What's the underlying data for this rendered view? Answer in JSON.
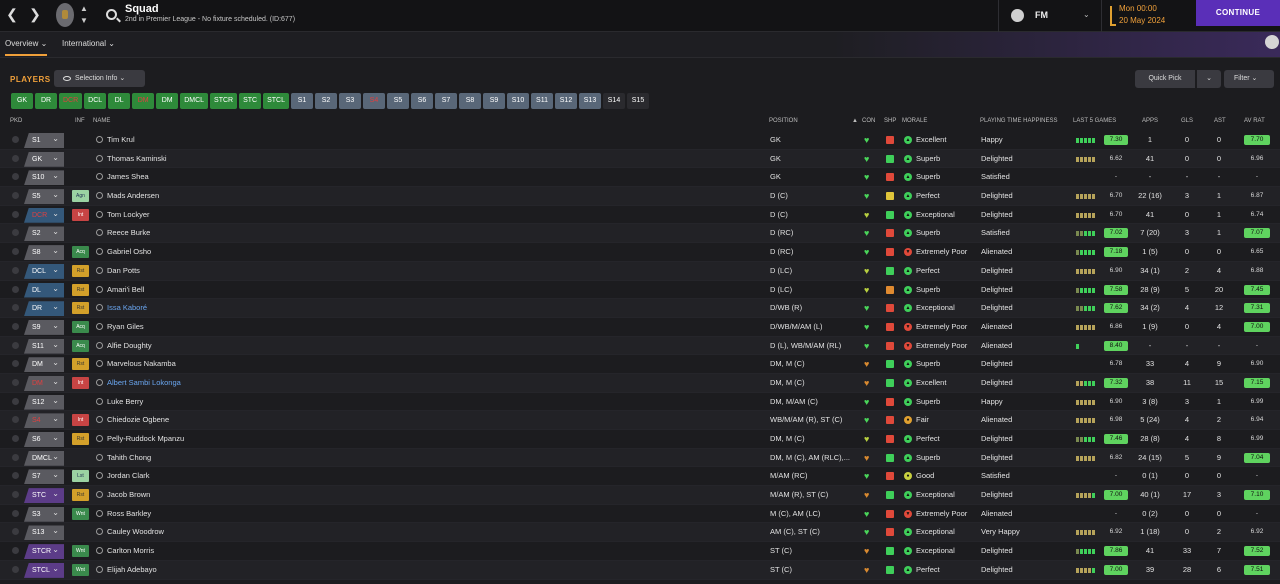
{
  "header": {
    "back_icon": "chevron-left-icon",
    "forward_icon": "chevron-right-icon",
    "title": "Squad",
    "subtitle": "2nd in Premier League - No fixture scheduled. (ID:677)",
    "user": "FM",
    "time": "Mon 00:00",
    "date": "20 May 2024",
    "continue_label": "CONTINUE"
  },
  "tabs": [
    {
      "label": "Overview ⌄"
    },
    {
      "label": "International ⌄"
    }
  ],
  "toolbar": {
    "players_label": "PLAYERS",
    "selection_info_label": "Selection Info ⌄",
    "quick_pick_label": "Quick Pick",
    "quick_pick_dd": "⌄",
    "filter_label": "Filter ⌄"
  },
  "position_chips": [
    {
      "label": "GK",
      "style": "g"
    },
    {
      "label": "DR",
      "style": "g"
    },
    {
      "label": "DCR",
      "style": "gr"
    },
    {
      "label": "DCL",
      "style": "g"
    },
    {
      "label": "DL",
      "style": "g"
    },
    {
      "label": "DM",
      "style": "gr"
    },
    {
      "label": "DM",
      "style": "g"
    },
    {
      "label": "DMCL",
      "style": "g"
    },
    {
      "label": "STCR",
      "style": "g"
    },
    {
      "label": "STC",
      "style": "g"
    },
    {
      "label": "STCL",
      "style": "g"
    },
    {
      "label": "S1",
      "style": "s"
    },
    {
      "label": "S2",
      "style": "s"
    },
    {
      "label": "S3",
      "style": "s"
    },
    {
      "label": "S4",
      "style": "sr"
    },
    {
      "label": "S5",
      "style": "s"
    },
    {
      "label": "S6",
      "style": "s"
    },
    {
      "label": "S7",
      "style": "s"
    },
    {
      "label": "S8",
      "style": "s"
    },
    {
      "label": "S9",
      "style": "s"
    },
    {
      "label": "S10",
      "style": "s"
    },
    {
      "label": "S11",
      "style": "s"
    },
    {
      "label": "S12",
      "style": "s"
    },
    {
      "label": "S13",
      "style": "s"
    },
    {
      "label": "S14",
      "style": "d"
    },
    {
      "label": "S15",
      "style": "d"
    }
  ],
  "columns": {
    "pkd": "PKD",
    "inf": "INF",
    "name": "NAME",
    "position": "POSITION",
    "con": "CON",
    "shp": "SHP",
    "morale": "MORALE",
    "pth": "PLAYING TIME HAPPINESS",
    "last5": "LAST 5 GAMES",
    "apps": "APPS",
    "gls": "GLS",
    "ast": "AST",
    "avrat": "AV RAT"
  },
  "players": [
    {
      "pkd": "S1",
      "pkd_style": "",
      "pkd_red": false,
      "inf": "",
      "name": "Tim Krul",
      "link": false,
      "position": "GK",
      "con": "#4ad65a",
      "shp": "red",
      "morale": "Excellent",
      "morale_icon": "up",
      "pth": "Happy",
      "bars": [
        "g",
        "g",
        "g",
        "g",
        "g"
      ],
      "last5": "7.30",
      "l5": "gr",
      "apps": "1",
      "gls": "0",
      "ast": "0",
      "avrat": "7.70",
      "av": "gr"
    },
    {
      "pkd": "GK",
      "pkd_style": "",
      "pkd_red": false,
      "inf": "",
      "name": "Thomas Kaminski",
      "link": false,
      "position": "GK",
      "con": "#4ad65a",
      "shp": "green",
      "morale": "Superb",
      "morale_icon": "up2",
      "pth": "Delighted",
      "bars": [
        "y",
        "y",
        "y",
        "y",
        "y"
      ],
      "last5": "6.62",
      "l5": "no",
      "apps": "41",
      "gls": "0",
      "ast": "0",
      "avrat": "6.96",
      "av": "no"
    },
    {
      "pkd": "S10",
      "pkd_style": "",
      "pkd_red": false,
      "inf": "",
      "name": "James Shea",
      "link": false,
      "position": "GK",
      "con": "#4ad65a",
      "shp": "red",
      "morale": "Superb",
      "morale_icon": "up2",
      "pth": "Satisfied",
      "bars": [],
      "last5": "-",
      "l5": "no",
      "apps": "-",
      "gls": "-",
      "ast": "-",
      "avrat": "-",
      "av": "no"
    },
    {
      "pkd": "S5",
      "pkd_style": "",
      "pkd_red": false,
      "inf": "Agn",
      "inf_style": "lg",
      "name": "Mads Andersen",
      "link": false,
      "position": "D (C)",
      "con": "#4ad65a",
      "shp": "yellow",
      "morale": "Perfect",
      "morale_icon": "up2",
      "pth": "Delighted",
      "bars": [
        "y",
        "y",
        "y",
        "y",
        "y"
      ],
      "last5": "6.70",
      "l5": "no",
      "apps": "22 (16)",
      "gls": "3",
      "ast": "1",
      "avrat": "6.87",
      "av": "no"
    },
    {
      "pkd": "DCR",
      "pkd_style": "b",
      "pkd_red": true,
      "inf": "Int",
      "inf_style": "red",
      "name": "Tom Lockyer",
      "link": false,
      "position": "D (C)",
      "con": "#b8d040",
      "shp": "green",
      "morale": "Exceptional",
      "morale_icon": "up2",
      "pth": "Delighted",
      "bars": [
        "y",
        "y",
        "y",
        "y",
        "y"
      ],
      "last5": "6.70",
      "l5": "no",
      "apps": "41",
      "gls": "0",
      "ast": "1",
      "avrat": "6.74",
      "av": "no"
    },
    {
      "pkd": "S2",
      "pkd_style": "",
      "pkd_red": false,
      "inf": "",
      "name": "Reece Burke",
      "link": false,
      "position": "D (RC)",
      "con": "#4ad65a",
      "shp": "red",
      "morale": "Superb",
      "morale_icon": "up2",
      "pth": "Satisfied",
      "bars": [
        "dg",
        "dg",
        "g",
        "g",
        "g"
      ],
      "last5": "7.02",
      "l5": "gr",
      "apps": "7 (20)",
      "gls": "3",
      "ast": "1",
      "avrat": "7.07",
      "av": "gr"
    },
    {
      "pkd": "S8",
      "pkd_style": "",
      "pkd_red": false,
      "inf": "Acq",
      "inf_style": "grn",
      "name": "Gabriel Osho",
      "link": false,
      "position": "D (RC)",
      "con": "#4ad65a",
      "shp": "red",
      "morale": "Extremely Poor",
      "morale_icon": "down",
      "pth": "Alienated",
      "bars": [
        "dg",
        "g",
        "g",
        "g",
        "g"
      ],
      "last5": "7.18",
      "l5": "gr",
      "apps": "1 (5)",
      "gls": "0",
      "ast": "0",
      "avrat": "6.65",
      "av": "no"
    },
    {
      "pkd": "DCL",
      "pkd_style": "b",
      "pkd_red": false,
      "inf": "Rst",
      "inf_style": "yel",
      "name": "Dan Potts",
      "link": false,
      "position": "D (LC)",
      "con": "#b8d040",
      "shp": "green",
      "morale": "Perfect",
      "morale_icon": "up2",
      "pth": "Delighted",
      "bars": [
        "y",
        "y",
        "y",
        "y",
        "y"
      ],
      "last5": "6.90",
      "l5": "no",
      "apps": "34 (1)",
      "gls": "2",
      "ast": "4",
      "avrat": "6.88",
      "av": "no"
    },
    {
      "pkd": "DL",
      "pkd_style": "b",
      "pkd_red": false,
      "inf": "Rst",
      "inf_style": "yel",
      "name": "Amari'i Bell",
      "link": false,
      "position": "D (LC)",
      "con": "#b8d040",
      "shp": "orange",
      "morale": "Superb",
      "morale_icon": "up2",
      "pth": "Delighted",
      "bars": [
        "dg",
        "g",
        "g",
        "g",
        "g"
      ],
      "last5": "7.58",
      "l5": "gr",
      "apps": "28 (9)",
      "gls": "5",
      "ast": "20",
      "avrat": "7.45",
      "av": "gr"
    },
    {
      "pkd": "DR",
      "pkd_style": "b",
      "pkd_red": false,
      "inf": "Rst",
      "inf_style": "yel",
      "name": "Issa Kaboré",
      "link": true,
      "position": "D/WB (R)",
      "con": "#4ad65a",
      "shp": "red",
      "morale": "Exceptional",
      "morale_icon": "up2",
      "pth": "Delighted",
      "bars": [
        "dg",
        "dg",
        "g",
        "g",
        "g"
      ],
      "last5": "7.62",
      "l5": "gr",
      "apps": "34 (2)",
      "gls": "4",
      "ast": "12",
      "avrat": "7.31",
      "av": "gr"
    },
    {
      "pkd": "S9",
      "pkd_style": "",
      "pkd_red": false,
      "inf": "Acq",
      "inf_style": "grn",
      "name": "Ryan Giles",
      "link": false,
      "position": "D/WB/M/AM (L)",
      "con": "#4ad65a",
      "shp": "red",
      "morale": "Extremely Poor",
      "morale_icon": "down",
      "pth": "Alienated",
      "bars": [
        "y",
        "y",
        "y",
        "y",
        "y"
      ],
      "last5": "6.86",
      "l5": "no",
      "apps": "1 (9)",
      "gls": "0",
      "ast": "4",
      "avrat": "7.00",
      "av": "gr"
    },
    {
      "pkd": "S11",
      "pkd_style": "",
      "pkd_red": false,
      "inf": "Acq",
      "inf_style": "grn",
      "name": "Alfie Doughty",
      "link": false,
      "position": "D (L), WB/M/AM (RL)",
      "con": "#4ad65a",
      "shp": "red",
      "morale": "Extremely Poor",
      "morale_icon": "down",
      "pth": "Alienated",
      "bars": [
        "g"
      ],
      "last5": "8.40",
      "l5": "gr",
      "apps": "-",
      "gls": "-",
      "ast": "-",
      "avrat": "-",
      "av": "no"
    },
    {
      "pkd": "DM",
      "pkd_style": "",
      "pkd_red": false,
      "inf": "Rst",
      "inf_style": "yel",
      "name": "Marvelous Nakamba",
      "link": false,
      "position": "DM, M (C)",
      "con": "#d98a30",
      "shp": "green",
      "morale": "Superb",
      "morale_icon": "up2",
      "pth": "Delighted",
      "bars": [],
      "last5": "6.78",
      "l5": "no",
      "apps": "33",
      "gls": "4",
      "ast": "9",
      "avrat": "6.90",
      "av": "no"
    },
    {
      "pkd": "DM",
      "pkd_style": "",
      "pkd_red": true,
      "inf": "Int",
      "inf_style": "red",
      "name": "Albert Sambi Lokonga",
      "link": true,
      "position": "DM, M (C)",
      "con": "#d98a30",
      "shp": "green",
      "morale": "Excellent",
      "morale_icon": "up",
      "pth": "Delighted",
      "bars": [
        "y",
        "y",
        "g",
        "g",
        "g"
      ],
      "last5": "7.32",
      "l5": "gr",
      "apps": "38",
      "gls": "11",
      "ast": "15",
      "avrat": "7.15",
      "av": "gr"
    },
    {
      "pkd": "S12",
      "pkd_style": "",
      "pkd_red": false,
      "inf": "",
      "name": "Luke Berry",
      "link": false,
      "position": "DM, M/AM (C)",
      "con": "#4ad65a",
      "shp": "red",
      "morale": "Superb",
      "morale_icon": "up2",
      "pth": "Happy",
      "bars": [
        "y",
        "y",
        "y",
        "y",
        "y"
      ],
      "last5": "6.90",
      "l5": "no",
      "apps": "3 (8)",
      "gls": "3",
      "ast": "1",
      "avrat": "6.99",
      "av": "no"
    },
    {
      "pkd": "S4",
      "pkd_style": "",
      "pkd_red": true,
      "inf": "Int",
      "inf_style": "red",
      "name": "Chiedozie Ogbene",
      "link": false,
      "position": "WB/M/AM (R), ST (C)",
      "con": "#4ad65a",
      "shp": "red",
      "morale": "Fair",
      "morale_icon": "flat",
      "pth": "Alienated",
      "bars": [
        "y",
        "y",
        "y",
        "y",
        "y"
      ],
      "last5": "6.98",
      "l5": "no",
      "apps": "5 (24)",
      "gls": "4",
      "ast": "2",
      "avrat": "6.94",
      "av": "no"
    },
    {
      "pkd": "S6",
      "pkd_style": "",
      "pkd_red": false,
      "inf": "Rst",
      "inf_style": "yel",
      "name": "Pelly-Ruddock Mpanzu",
      "link": false,
      "position": "DM, M (C)",
      "con": "#b8d040",
      "shp": "red",
      "morale": "Perfect",
      "morale_icon": "up2",
      "pth": "Delighted",
      "bars": [
        "dg",
        "dg",
        "g",
        "g",
        "g"
      ],
      "last5": "7.46",
      "l5": "gr",
      "apps": "28 (8)",
      "gls": "4",
      "ast": "8",
      "avrat": "6.99",
      "av": "no"
    },
    {
      "pkd": "DMCL",
      "pkd_style": "",
      "pkd_red": false,
      "inf": "",
      "name": "Tahith Chong",
      "link": false,
      "position": "DM, M (C), AM (RLC),...",
      "con": "#d98a30",
      "shp": "green",
      "morale": "Superb",
      "morale_icon": "up2",
      "pth": "Delighted",
      "bars": [
        "y",
        "y",
        "y",
        "y",
        "y"
      ],
      "last5": "6.82",
      "l5": "no",
      "apps": "24 (15)",
      "gls": "5",
      "ast": "9",
      "avrat": "7.04",
      "av": "gr"
    },
    {
      "pkd": "S7",
      "pkd_style": "",
      "pkd_red": false,
      "inf": "Lst",
      "inf_style": "lg",
      "name": "Jordan Clark",
      "link": false,
      "position": "M/AM (RC)",
      "con": "#4ad65a",
      "shp": "red",
      "morale": "Good",
      "morale_icon": "flat2",
      "pth": "Satisfied",
      "bars": [],
      "last5": "-",
      "l5": "no",
      "apps": "0 (1)",
      "gls": "0",
      "ast": "0",
      "avrat": "-",
      "av": "no"
    },
    {
      "pkd": "STC",
      "pkd_style": "p",
      "pkd_red": false,
      "inf": "Rst",
      "inf_style": "yel",
      "name": "Jacob Brown",
      "link": false,
      "position": "M/AM (R), ST (C)",
      "con": "#d98a30",
      "shp": "green",
      "morale": "Exceptional",
      "morale_icon": "up2",
      "pth": "Delighted",
      "bars": [
        "y",
        "y",
        "y",
        "y",
        "g"
      ],
      "last5": "7.00",
      "l5": "gr",
      "apps": "40 (1)",
      "gls": "17",
      "ast": "3",
      "avrat": "7.10",
      "av": "gr"
    },
    {
      "pkd": "S3",
      "pkd_style": "",
      "pkd_red": false,
      "inf": "Wnt",
      "inf_style": "grn",
      "name": "Ross Barkley",
      "link": false,
      "position": "M (C), AM (LC)",
      "con": "#4ad65a",
      "shp": "red",
      "morale": "Extremely Poor",
      "morale_icon": "down",
      "pth": "Alienated",
      "bars": [],
      "last5": "-",
      "l5": "no",
      "apps": "0 (2)",
      "gls": "0",
      "ast": "0",
      "avrat": "-",
      "av": "no"
    },
    {
      "pkd": "S13",
      "pkd_style": "",
      "pkd_red": false,
      "inf": "",
      "name": "Cauley Woodrow",
      "link": false,
      "position": "AM (C), ST (C)",
      "con": "#4ad65a",
      "shp": "red",
      "morale": "Exceptional",
      "morale_icon": "up2",
      "pth": "Very Happy",
      "bars": [
        "y",
        "y",
        "y",
        "y",
        "y"
      ],
      "last5": "6.92",
      "l5": "no",
      "apps": "1 (18)",
      "gls": "0",
      "ast": "2",
      "avrat": "6.92",
      "av": "no"
    },
    {
      "pkd": "STCR",
      "pkd_style": "p",
      "pkd_red": false,
      "inf": "Wnt",
      "inf_style": "grn",
      "name": "Carlton Morris",
      "link": false,
      "position": "ST (C)",
      "con": "#d98a30",
      "shp": "green",
      "morale": "Exceptional",
      "morale_icon": "up2",
      "pth": "Delighted",
      "bars": [
        "dg",
        "g",
        "g",
        "g",
        "g"
      ],
      "last5": "7.86",
      "l5": "gr",
      "apps": "41",
      "gls": "33",
      "ast": "7",
      "avrat": "7.52",
      "av": "gr"
    },
    {
      "pkd": "STCL",
      "pkd_style": "p",
      "pkd_red": false,
      "inf": "Wnt",
      "inf_style": "grn",
      "name": "Elijah Adebayo",
      "link": false,
      "position": "ST (C)",
      "con": "#d98a30",
      "shp": "green",
      "morale": "Perfect",
      "morale_icon": "up2",
      "pth": "Delighted",
      "bars": [
        "y",
        "y",
        "y",
        "y",
        "g"
      ],
      "last5": "7.00",
      "l5": "gr",
      "apps": "39",
      "gls": "28",
      "ast": "6",
      "avrat": "7.51",
      "av": "gr"
    }
  ],
  "colors": {
    "accent": "#f0a03a",
    "continue": "#5a2fb8",
    "good": "#5fd35f"
  }
}
